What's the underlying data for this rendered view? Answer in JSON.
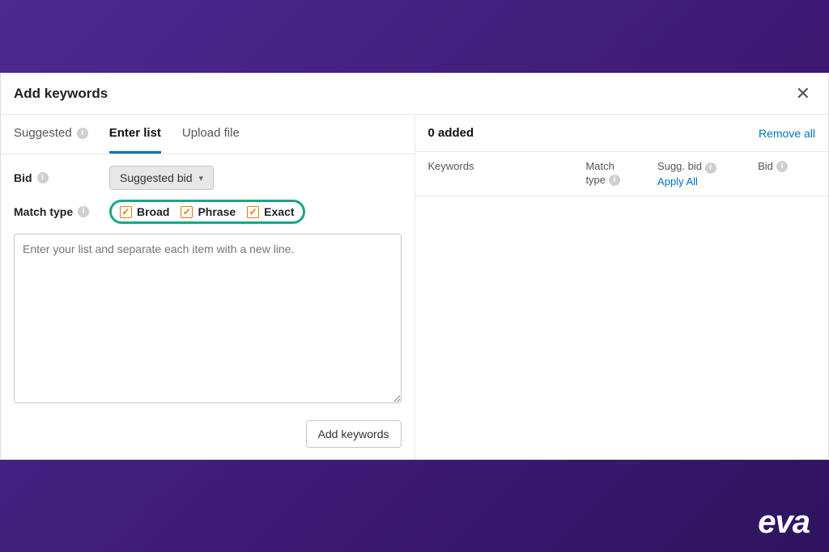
{
  "modal": {
    "title": "Add keywords",
    "close": "✕"
  },
  "tabs": {
    "suggested": "Suggested",
    "enter_list": "Enter list",
    "upload_file": "Upload file"
  },
  "form": {
    "bid_label": "Bid",
    "bid_dropdown": "Suggested bid",
    "match_type_label": "Match type",
    "match_broad": "Broad",
    "match_phrase": "Phrase",
    "match_exact": "Exact",
    "textarea_placeholder": "Enter your list and separate each item with a new line.",
    "add_button": "Add keywords"
  },
  "right": {
    "added_count": "0 added",
    "remove_all": "Remove all",
    "columns": {
      "keywords": "Keywords",
      "match_type": "Match",
      "match_type2": "type",
      "sugg_bid": "Sugg. bid",
      "apply_all": "Apply All",
      "bid": "Bid"
    }
  },
  "brand": "eva"
}
